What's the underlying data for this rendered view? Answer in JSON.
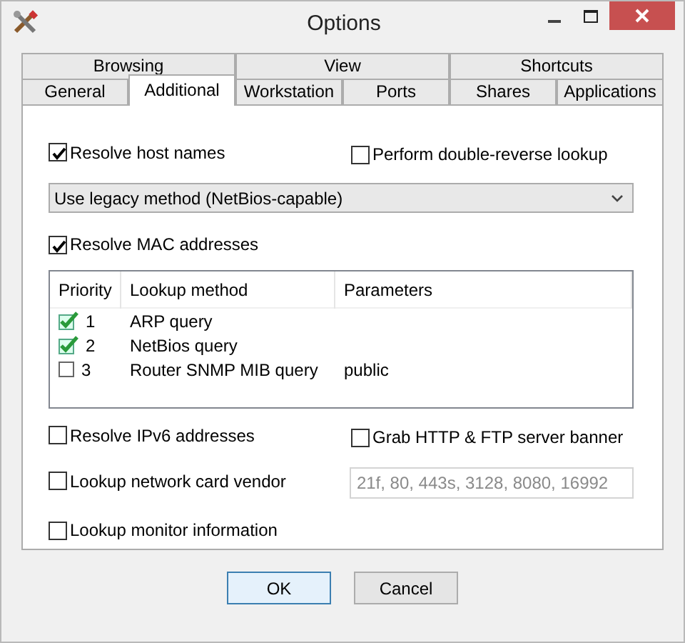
{
  "window": {
    "title": "Options"
  },
  "tabs": [
    [
      {
        "label": "Browsing",
        "selected": false
      },
      {
        "label": "View",
        "selected": false
      },
      {
        "label": "Shortcuts",
        "selected": false
      }
    ],
    [
      {
        "label": "General",
        "selected": false
      },
      {
        "label": "Additional",
        "selected": true
      },
      {
        "label": "Workstation",
        "selected": false
      },
      {
        "label": "Ports",
        "selected": false
      },
      {
        "label": "Shares",
        "selected": false
      },
      {
        "label": "Applications",
        "selected": false
      }
    ]
  ],
  "resolve_host_names": {
    "label": "Resolve host names",
    "checked": true
  },
  "double_reverse_lookup": {
    "label": "Perform double-reverse lookup",
    "checked": false
  },
  "method_dropdown": {
    "value": "Use legacy method (NetBios-capable)"
  },
  "resolve_mac": {
    "label": "Resolve MAC addresses",
    "checked": true
  },
  "lookup_table": {
    "columns": [
      "Priority",
      "Lookup method",
      "Parameters"
    ],
    "rows": [
      {
        "checked": true,
        "priority": "1",
        "method": "ARP query",
        "parameters": ""
      },
      {
        "checked": true,
        "priority": "2",
        "method": "NetBios query",
        "parameters": ""
      },
      {
        "checked": false,
        "priority": "3",
        "method": "Router SNMP MIB query",
        "parameters": "public"
      }
    ]
  },
  "resolve_ipv6": {
    "label": "Resolve IPv6 addresses",
    "checked": false
  },
  "grab_banner": {
    "label": "Grab HTTP & FTP server banner",
    "checked": false
  },
  "network_card_vendor": {
    "label": "Lookup network card vendor",
    "checked": false
  },
  "banner_ports": {
    "value": "21f, 80, 443s, 3128, 8080, 16992",
    "disabled": true
  },
  "monitor_info": {
    "label": "Lookup monitor information",
    "checked": false
  },
  "buttons": [
    {
      "label": "OK",
      "default": true
    },
    {
      "label": "Cancel",
      "default": false
    }
  ]
}
